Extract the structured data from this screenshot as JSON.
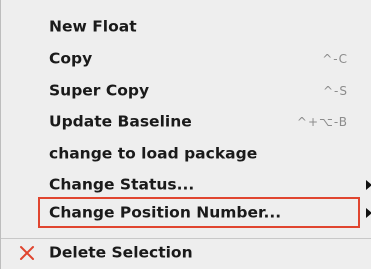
{
  "menu": {
    "items": [
      {
        "label": "New Float",
        "shortcut": ""
      },
      {
        "label": "Copy",
        "shortcut": "^-C"
      },
      {
        "label": "Super Copy",
        "shortcut": "^-S"
      },
      {
        "label": "Update Baseline",
        "shortcut": "^+⌥-B"
      },
      {
        "label": "change to load package",
        "shortcut": ""
      },
      {
        "label": "Change Status...",
        "shortcut": "",
        "submenu": true
      },
      {
        "label": "Change Position Number...",
        "shortcut": "",
        "submenu": true,
        "highlighted": true
      }
    ],
    "delete_item": {
      "label": "Delete Selection",
      "icon": "x-delete-icon"
    }
  },
  "colors": {
    "background": "#eeeeee",
    "highlight_border": "#e0452f",
    "delete_icon": "#e0452f",
    "shortcut_text": "#8c8c8c"
  }
}
